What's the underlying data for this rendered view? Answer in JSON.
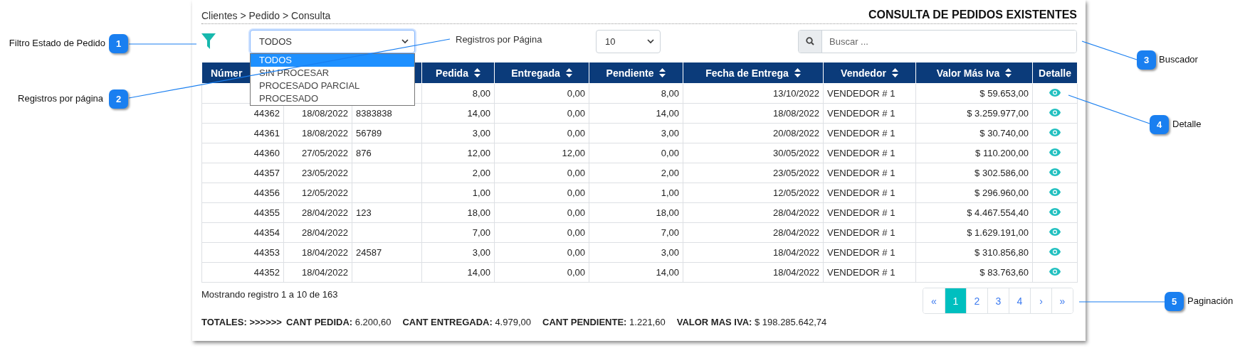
{
  "callouts": [
    {
      "number": "1",
      "label": "Filtro Estado de Pedido"
    },
    {
      "number": "2",
      "label": "Registros por página"
    },
    {
      "number": "3",
      "label": "Buscador"
    },
    {
      "number": "4",
      "label": "Detalle"
    },
    {
      "number": "5",
      "label": "Paginación"
    }
  ],
  "breadcrumb": "Clientes > Pedido > Consulta",
  "page_title": "CONSULTA DE PEDIDOS EXISTENTES",
  "status_filter": {
    "value": "TODOS",
    "expanded": true,
    "options": [
      {
        "label": "TODOS",
        "selected": true
      },
      {
        "label": "SIN PROCESAR",
        "selected": false
      },
      {
        "label": "PROCESADO PARCIAL",
        "selected": false
      },
      {
        "label": "PROCESADO",
        "selected": false
      }
    ]
  },
  "page_size": {
    "label": "Registros por Página",
    "value": "10"
  },
  "search": {
    "placeholder": "Buscar ..."
  },
  "table": {
    "columns": [
      {
        "label": "Númer",
        "sortable": false
      },
      {},
      {},
      {
        "label": "Pedida",
        "sortable": true
      },
      {
        "label": "Entregada",
        "sortable": true
      },
      {
        "label": "Pendiente",
        "sortable": true
      },
      {
        "label": "Fecha de Entrega",
        "sortable": true
      },
      {
        "label": "Vendedor",
        "sortable": true
      },
      {
        "label": "Valor Más Iva",
        "sortable": true
      },
      {
        "label": "Detalle",
        "sortable": false
      }
    ],
    "rows": [
      {
        "cells": [
          null,
          null,
          null,
          "8,00",
          "0,00",
          "8,00",
          "13/10/2022",
          "VENDEDOR # 1",
          "$ 59.653,00"
        ]
      },
      {
        "cells": [
          "44362",
          "18/08/2022",
          "8383838",
          "14,00",
          "0,00",
          "14,00",
          "18/08/2022",
          "VENDEDOR # 1",
          "$ 3.259.977,00"
        ]
      },
      {
        "cells": [
          "44361",
          "18/08/2022",
          "56789",
          "3,00",
          "0,00",
          "3,00",
          "20/08/2022",
          "VENDEDOR # 1",
          "$ 30.740,00"
        ]
      },
      {
        "cells": [
          "44360",
          "27/05/2022",
          "876",
          "12,00",
          "12,00",
          "0,00",
          "30/05/2022",
          "VENDEDOR # 1",
          "$ 110.200,00"
        ]
      },
      {
        "cells": [
          "44357",
          "23/05/2022",
          null,
          "2,00",
          "0,00",
          "2,00",
          "23/05/2022",
          "VENDEDOR # 1",
          "$ 302.586,00"
        ]
      },
      {
        "cells": [
          "44356",
          "12/05/2022",
          null,
          "1,00",
          "0,00",
          "1,00",
          "12/05/2022",
          "VENDEDOR # 1",
          "$ 296.960,00"
        ]
      },
      {
        "cells": [
          "44355",
          "28/04/2022",
          "123",
          "18,00",
          "0,00",
          "18,00",
          "28/04/2022",
          "VENDEDOR # 1",
          "$ 4.467.554,40"
        ]
      },
      {
        "cells": [
          "44354",
          "28/04/2022",
          null,
          "7,00",
          "0,00",
          "7,00",
          "28/04/2022",
          "VENDEDOR # 1",
          "$ 1.629.191,00"
        ]
      },
      {
        "cells": [
          "44353",
          "18/04/2022",
          "24587",
          "3,00",
          "0,00",
          "3,00",
          "18/04/2022",
          "VENDEDOR # 1",
          "$ 310.856,80"
        ]
      },
      {
        "cells": [
          "44352",
          "18/04/2022",
          null,
          "14,00",
          "0,00",
          "14,00",
          "18/04/2022",
          "VENDEDOR # 1",
          "$ 83.763,60"
        ]
      }
    ]
  },
  "record_count": "Mostrando registro 1 a 10 de 163",
  "pagination": [
    {
      "label": "«",
      "selected": false
    },
    {
      "label": "1",
      "selected": true
    },
    {
      "label": "2",
      "selected": false
    },
    {
      "label": "3",
      "selected": false
    },
    {
      "label": "4",
      "selected": false
    },
    {
      "label": "›",
      "selected": false
    },
    {
      "label": "»",
      "selected": false
    }
  ],
  "totals": {
    "label": "TOTALES: >>>>>>",
    "items": [
      {
        "label": "CANT PEDIDA:",
        "value": "6.200,60"
      },
      {
        "label": "CANT ENTREGADA:",
        "value": "4.979,00"
      },
      {
        "label": "CANT PENDIENTE:",
        "value": "1.221,60"
      },
      {
        "label": "VALOR MAS IVA:",
        "value": "$ 198.285.642,74"
      }
    ]
  }
}
